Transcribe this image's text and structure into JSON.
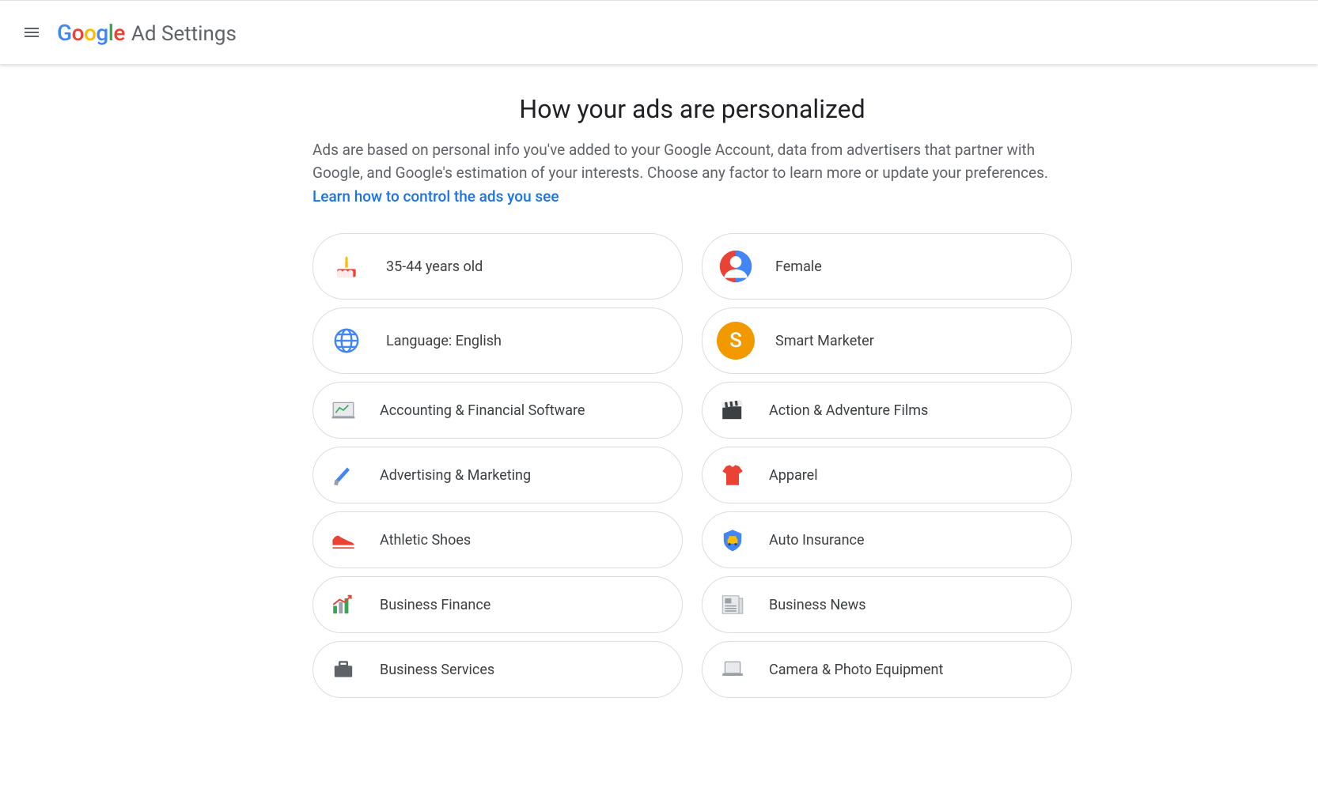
{
  "header": {
    "logo_letters": [
      "G",
      "o",
      "o",
      "g",
      "l",
      "e"
    ],
    "product_name": "Ad Settings"
  },
  "title": "How your ads are personalized",
  "description": "Ads are based on personal info you've added to your Google Account, data from advertisers that partner with Google, and Google's estimation of your interests. Choose any factor to learn more or update your preferences. ",
  "link_text": "Learn how to control the ads you see",
  "factors": [
    {
      "icon": "birthday-cake-icon",
      "label": "35-44 years old",
      "tall": true
    },
    {
      "icon": "person-icon",
      "label": "Female",
      "tall": true
    },
    {
      "icon": "globe-icon",
      "label": "Language: English",
      "tall": true
    },
    {
      "icon": "smart-marketer-icon",
      "label": "Smart Marketer",
      "tall": true
    },
    {
      "icon": "accounting-icon",
      "label": "Accounting & Financial Software"
    },
    {
      "icon": "film-clapper-icon",
      "label": "Action & Adventure Films"
    },
    {
      "icon": "megaphone-icon",
      "label": "Advertising & Marketing"
    },
    {
      "icon": "tshirt-icon",
      "label": "Apparel"
    },
    {
      "icon": "sneaker-icon",
      "label": "Athletic Shoes"
    },
    {
      "icon": "shield-car-icon",
      "label": "Auto Insurance"
    },
    {
      "icon": "bar-chart-icon",
      "label": "Business Finance"
    },
    {
      "icon": "newspaper-icon",
      "label": "Business News"
    },
    {
      "icon": "briefcase-icon",
      "label": "Business Services"
    },
    {
      "icon": "laptop-icon",
      "label": "Camera & Photo Equipment"
    }
  ],
  "colors": {
    "google_blue": "#4285F4",
    "google_red": "#EA4335",
    "google_yellow": "#FBBC05",
    "google_green": "#34A853",
    "orange": "#F29900",
    "grey": "#5f6368"
  }
}
